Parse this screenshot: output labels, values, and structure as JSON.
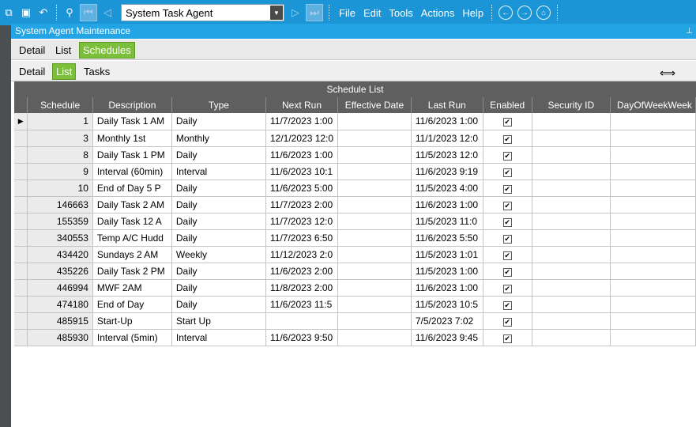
{
  "toolbar": {
    "agent_select": "System Task Agent",
    "menu": [
      "File",
      "Edit",
      "Tools",
      "Actions",
      "Help"
    ]
  },
  "window": {
    "title": "System Agent Maintenance"
  },
  "tabs_top": [
    "Detail",
    "List",
    "Schedules"
  ],
  "tabs_sub": [
    "Detail",
    "List",
    "Tasks"
  ],
  "grid": {
    "caption": "Schedule List",
    "columns": [
      "Schedule",
      "Description",
      "Type",
      "Next Run",
      "Effective Date",
      "Last Run",
      "Enabled",
      "Security ID",
      "DayOfWeekWeek"
    ],
    "rows": [
      [
        "1",
        "Daily Task 1 AM",
        "Daily",
        "11/7/2023 1:00",
        "",
        "11/6/2023 1:00",
        "true",
        "",
        ""
      ],
      [
        "3",
        "Monthly 1st",
        "Monthly",
        "12/1/2023 12:0",
        "",
        "11/1/2023 12:0",
        "true",
        "",
        ""
      ],
      [
        "8",
        "Daily Task 1 PM",
        "Daily",
        "11/6/2023 1:00",
        "",
        "11/5/2023 12:0",
        "true",
        "",
        ""
      ],
      [
        "9",
        "Interval (60min)",
        "Interval",
        "11/6/2023 10:1",
        "",
        "11/6/2023 9:19",
        "true",
        "",
        ""
      ],
      [
        "10",
        "End of Day 5 P",
        "Daily",
        "11/6/2023 5:00",
        "",
        "11/5/2023 4:00",
        "true",
        "",
        ""
      ],
      [
        "146663",
        "Daily Task 2 AM",
        "Daily",
        "11/7/2023 2:00",
        "",
        "11/6/2023 1:00",
        "true",
        "",
        ""
      ],
      [
        "155359",
        "Daily Task 12 A",
        "Daily",
        "11/7/2023 12:0",
        "",
        "11/5/2023 11:0",
        "true",
        "",
        ""
      ],
      [
        "340553",
        "Temp A/C Hudd",
        "Daily",
        "11/7/2023 6:50",
        "",
        "11/6/2023 5:50",
        "true",
        "",
        ""
      ],
      [
        "434420",
        "Sundays 2 AM",
        "Weekly",
        "11/12/2023 2:0",
        "",
        "11/5/2023 1:01",
        "true",
        "",
        ""
      ],
      [
        "435226",
        "Daily Task 2 PM",
        "Daily",
        "11/6/2023 2:00",
        "",
        "11/5/2023 1:00",
        "true",
        "",
        ""
      ],
      [
        "446994",
        "MWF 2AM",
        "Daily",
        "11/8/2023 2:00",
        "",
        "11/6/2023 1:00",
        "true",
        "",
        ""
      ],
      [
        "474180",
        "End of Day",
        "Daily",
        "11/6/2023 11:5",
        "",
        "11/5/2023 10:5",
        "true",
        "",
        ""
      ],
      [
        "485915",
        "Start-Up",
        "Start Up",
        "",
        "",
        "7/5/2023 7:02",
        "true",
        "",
        ""
      ],
      [
        "485930",
        "Interval (5min)",
        "Interval",
        "11/6/2023 9:50",
        "",
        "11/6/2023 9:45",
        "true",
        "",
        ""
      ]
    ]
  }
}
